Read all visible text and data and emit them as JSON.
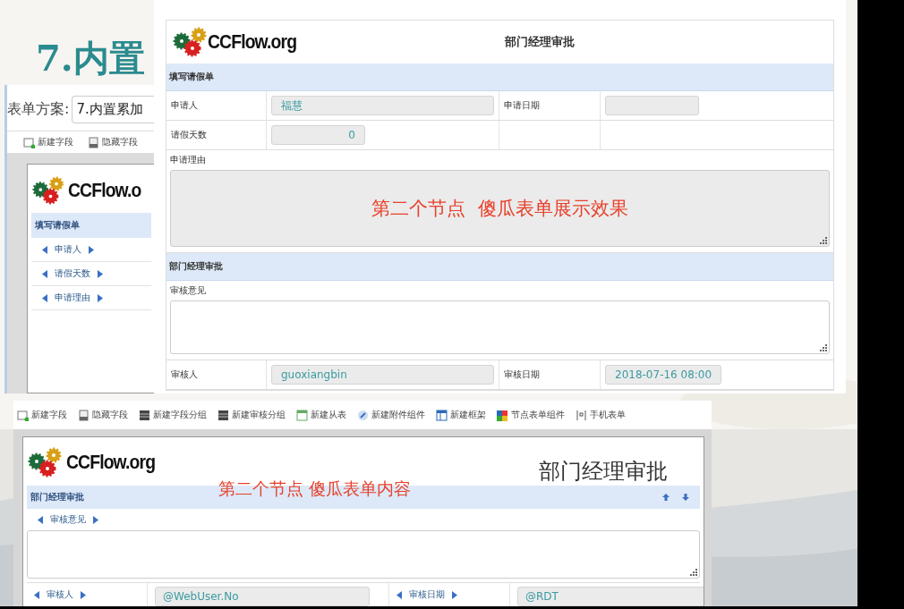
{
  "slide": {
    "title": "7.内置"
  },
  "back_window": {
    "scheme_label": "表单方案:",
    "scheme_value": "7.内置累加",
    "toolbar": [
      {
        "label": "新建字段"
      },
      {
        "label": "隐藏字段"
      }
    ],
    "form": {
      "logo": "CCFlow.o",
      "section": "填写请假单",
      "fields": [
        {
          "label": "申请人"
        },
        {
          "label": "请假天数"
        },
        {
          "label": "申请理由"
        }
      ]
    }
  },
  "front_form": {
    "logo": "CCFlow.org",
    "title": "部门经理审批",
    "sections": [
      {
        "title": "填写请假单",
        "rows": [
          {
            "kind": "grid",
            "cells": [
              {
                "kind": "label",
                "text": "申请人"
              },
              {
                "kind": "field",
                "value": "福慧"
              },
              {
                "kind": "label",
                "text": "申请日期"
              },
              {
                "kind": "short-field"
              }
            ]
          },
          {
            "kind": "grid",
            "cells": [
              {
                "kind": "label",
                "text": "请假天数"
              },
              {
                "kind": "number-field",
                "value": "0"
              },
              {
                "kind": "blank"
              },
              {
                "kind": "blank"
              }
            ]
          },
          {
            "kind": "textarea",
            "label": "申请理由",
            "readonly": true,
            "annotation": "第二个节点  傻瓜表单展示效果"
          }
        ]
      },
      {
        "title": "部门经理审批",
        "rows": [
          {
            "kind": "textarea",
            "label": "审核意见",
            "readonly": false
          },
          {
            "kind": "grid",
            "cells": [
              {
                "kind": "label",
                "text": "审核人"
              },
              {
                "kind": "field",
                "value": "guoxiangbin"
              },
              {
                "kind": "label",
                "text": "审核日期"
              },
              {
                "kind": "short-field",
                "value": "2018-07-16 08:00"
              }
            ]
          }
        ]
      }
    ]
  },
  "designer": {
    "toolbar": [
      {
        "label": "新建字段"
      },
      {
        "label": "隐藏字段"
      },
      {
        "label": "新建字段分组"
      },
      {
        "label": "新建审核分组"
      },
      {
        "label": "新建从表"
      },
      {
        "label": "新建附件组件"
      },
      {
        "label": "新建框架"
      },
      {
        "label": "节点表单组件"
      },
      {
        "label": "手机表单"
      }
    ],
    "form": {
      "logo": "CCFlow.org",
      "title": "部门经理审批",
      "annotation": "第二个节点 傻瓜表单内容",
      "section": "部门经理审批",
      "textarea_label": "审核意见",
      "row": [
        {
          "kind": "label",
          "text": "审核人"
        },
        {
          "kind": "field",
          "value": "@WebUser.No"
        },
        {
          "kind": "label",
          "text": "审核日期"
        },
        {
          "kind": "field",
          "value": "@RDT"
        }
      ]
    }
  }
}
